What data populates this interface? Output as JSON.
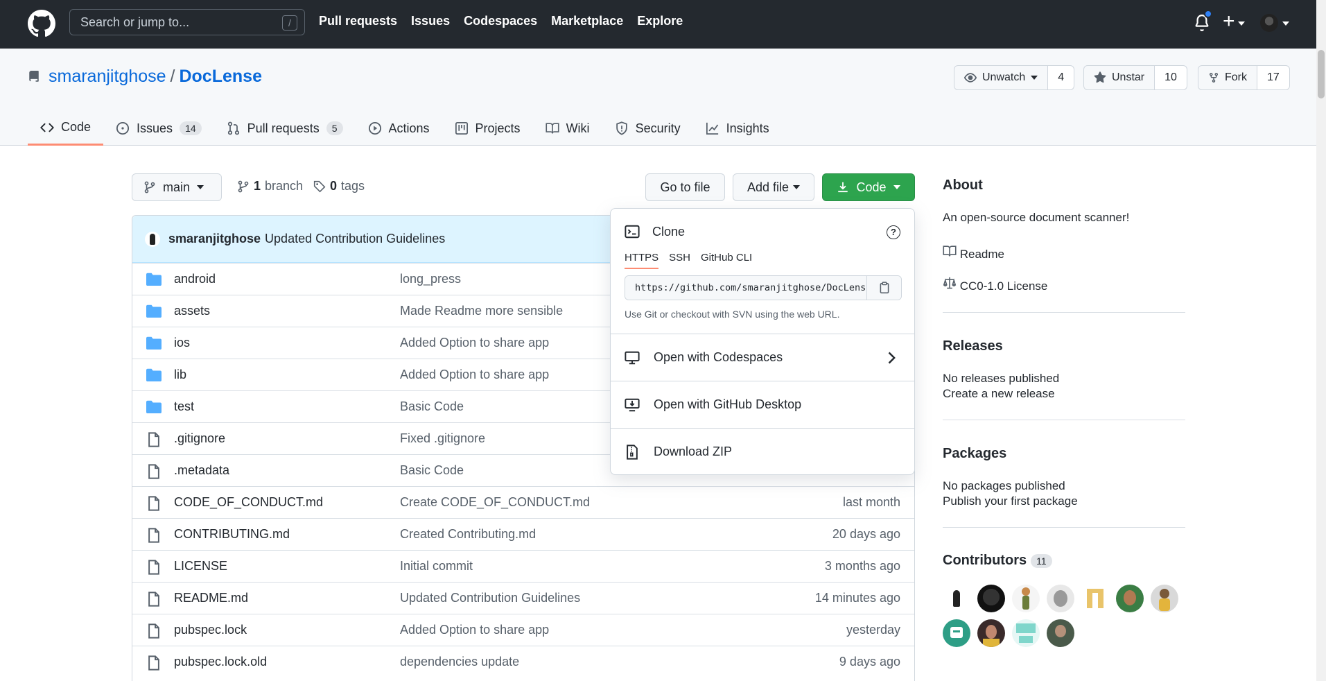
{
  "header": {
    "search_placeholder": "Search or jump to...",
    "search_key": "/",
    "nav": [
      "Pull requests",
      "Issues",
      "Codespaces",
      "Marketplace",
      "Explore"
    ],
    "plus": "+"
  },
  "repo": {
    "owner": "smaranjitghose",
    "separator": "/",
    "name": "DocLense",
    "watch_label": "Unwatch",
    "watch_count": "4",
    "star_label": "Unstar",
    "star_count": "10",
    "fork_label": "Fork",
    "fork_count": "17"
  },
  "tabs": [
    {
      "label": "Code",
      "icon": "code-icon"
    },
    {
      "label": "Issues",
      "count": "14",
      "icon": "issue-icon"
    },
    {
      "label": "Pull requests",
      "count": "5",
      "icon": "pull-request-icon"
    },
    {
      "label": "Actions",
      "icon": "play-icon"
    },
    {
      "label": "Projects",
      "icon": "project-icon"
    },
    {
      "label": "Wiki",
      "icon": "book-icon"
    },
    {
      "label": "Security",
      "icon": "shield-icon"
    },
    {
      "label": "Insights",
      "icon": "graph-icon"
    }
  ],
  "toolbar": {
    "branch": "main",
    "branch_count": "1",
    "branch_word": "branch",
    "tag_count": "0",
    "tag_word": "tags",
    "go_to_file": "Go to file",
    "add_file": "Add file",
    "code": "Code"
  },
  "commit": {
    "author": "smaranjitghose",
    "message": "Updated Contribution Guidelines"
  },
  "files": [
    {
      "type": "dir",
      "name": "android",
      "msg": "long_press",
      "age": ""
    },
    {
      "type": "dir",
      "name": "assets",
      "msg": "Made Readme more sensible",
      "age": ""
    },
    {
      "type": "dir",
      "name": "ios",
      "msg": "Added Option to share app",
      "age": ""
    },
    {
      "type": "dir",
      "name": "lib",
      "msg": "Added Option to share app",
      "age": ""
    },
    {
      "type": "dir",
      "name": "test",
      "msg": "Basic Code",
      "age": ""
    },
    {
      "type": "file",
      "name": ".gitignore",
      "msg": "Fixed .gitignore",
      "age": ""
    },
    {
      "type": "file",
      "name": ".metadata",
      "msg": "Basic Code",
      "age": ""
    },
    {
      "type": "file",
      "name": "CODE_OF_CONDUCT.md",
      "msg": "Create CODE_OF_CONDUCT.md",
      "age": "last month"
    },
    {
      "type": "file",
      "name": "CONTRIBUTING.md",
      "msg": "Created Contributing.md",
      "age": "20 days ago"
    },
    {
      "type": "file",
      "name": "LICENSE",
      "msg": "Initial commit",
      "age": "3 months ago"
    },
    {
      "type": "file",
      "name": "README.md",
      "msg": "Updated Contribution Guidelines",
      "age": "14 minutes ago"
    },
    {
      "type": "file",
      "name": "pubspec.lock",
      "msg": "Added Option to share app",
      "age": "yesterday"
    },
    {
      "type": "file",
      "name": "pubspec.lock.old",
      "msg": "dependencies update",
      "age": "9 days ago"
    }
  ],
  "clone_menu": {
    "title": "Clone",
    "help": "?",
    "protocols": [
      "HTTPS",
      "SSH",
      "GitHub CLI"
    ],
    "active_protocol": "HTTPS",
    "url": "https://github.com/smaranjitghose/DocLense.git",
    "hint": "Use Git or checkout with SVN using the web URL.",
    "open_codespaces": "Open with Codespaces",
    "open_desktop": "Open with GitHub Desktop",
    "download_zip": "Download ZIP"
  },
  "about": {
    "heading": "About",
    "description": "An open-source document scanner!",
    "readme": "Readme",
    "license": "CC0-1.0 License"
  },
  "releases": {
    "heading": "Releases",
    "none": "No releases published",
    "create": "Create a new release"
  },
  "packages": {
    "heading": "Packages",
    "none": "No packages published",
    "publish": "Publish your first package"
  },
  "contributors": {
    "heading": "Contributors",
    "count": "11"
  },
  "colors": {
    "accent": "#0969da",
    "green": "#2da44e",
    "header_bg": "#24292f",
    "folder": "#54aeff",
    "tab_underline": "#fd8c73"
  }
}
